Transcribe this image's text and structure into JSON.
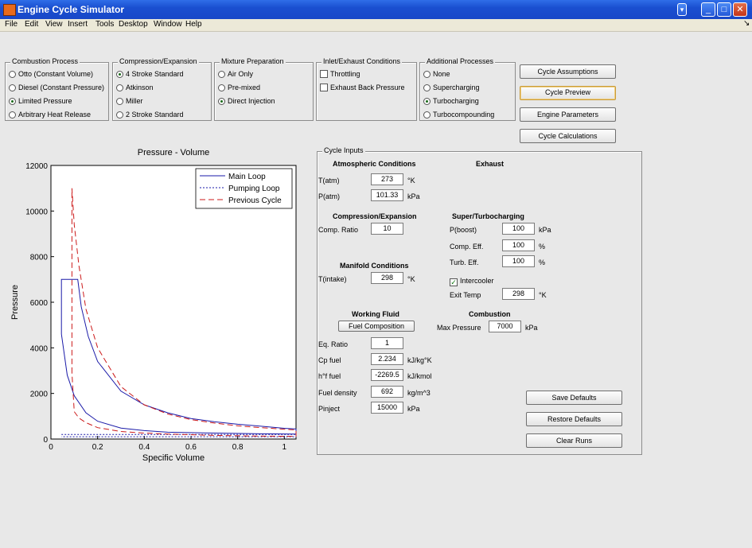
{
  "window": {
    "title": "Engine Cycle Simulator"
  },
  "menu": [
    "File",
    "Edit",
    "View",
    "Insert",
    "Tools",
    "Desktop",
    "Window",
    "Help"
  ],
  "combustion": {
    "title": "Combustion Process",
    "options": [
      "Otto (Constant Volume)",
      "Diesel (Constant Pressure)",
      "Limited Pressure",
      "Arbitrary Heat Release"
    ],
    "selected": 2
  },
  "compression": {
    "title": "Compression/Expansion",
    "options": [
      "4 Stroke Standard",
      "Atkinson",
      "Miller",
      "2 Stroke Standard"
    ],
    "selected": 0
  },
  "mixture": {
    "title": "Mixture Preparation",
    "options": [
      "Air Only",
      "Pre-mixed",
      "Direct Injection"
    ],
    "selected": 2
  },
  "inlet": {
    "title": "Inlet/Exhaust Conditions",
    "options": [
      "Throttling",
      "Exhaust Back Pressure"
    ]
  },
  "additional": {
    "title": "Additional Processes",
    "options": [
      "None",
      "Supercharging",
      "Turbocharging",
      "Turbocompounding"
    ],
    "selected": 2
  },
  "buttons": {
    "assumptions": "Cycle Assumptions",
    "preview": "Cycle Preview",
    "parameters": "Engine Parameters",
    "calculations": "Cycle Calculations",
    "save": "Save Defaults",
    "restore": "Restore Defaults",
    "clear": "Clear Runs",
    "fuel": "Fuel Composition"
  },
  "inputs": {
    "title": "Cycle Inputs",
    "atm_header": "Atmospheric Conditions",
    "exhaust_header": "Exhaust",
    "t_atm_label": "T(atm)",
    "t_atm": "273",
    "t_atm_unit": "°K",
    "p_atm_label": "P(atm)",
    "p_atm": "101.33",
    "p_atm_unit": "kPa",
    "comp_header": "Compression/Expansion",
    "comp_ratio_label": "Comp. Ratio",
    "comp_ratio": "10",
    "super_header": "Super/Turbocharging",
    "p_boost_label": "P(boost)",
    "p_boost": "100",
    "p_boost_unit": "kPa",
    "comp_eff_label": "Comp. Eff.",
    "comp_eff": "100",
    "comp_eff_unit": "%",
    "turb_eff_label": "Turb. Eff.",
    "turb_eff": "100",
    "turb_eff_unit": "%",
    "manifold_header": "Manifold Conditions",
    "t_intake_label": "T(intake)",
    "t_intake": "298",
    "t_intake_unit": "°K",
    "intercooler_label": "Intercooler",
    "exit_temp_label": "Exit Temp",
    "exit_temp": "298",
    "exit_temp_unit": "°K",
    "fluid_header": "Working Fluid",
    "combustion_header": "Combustion",
    "max_pressure_label": "Max Pressure",
    "max_pressure": "7000",
    "max_pressure_unit": "kPa",
    "eq_ratio_label": "Eq. Ratio",
    "eq_ratio": "1",
    "cp_fuel_label": "Cp fuel",
    "cp_fuel": "2.234",
    "cp_fuel_unit": "kJ/kg°K",
    "hf_fuel_label": "h°f fuel",
    "hf_fuel": "-2269.5",
    "hf_fuel_unit": "kJ/kmol",
    "fuel_density_label": "Fuel density",
    "fuel_density": "692",
    "fuel_density_unit": "kg/m^3",
    "pinject_label": "Pinject",
    "pinject": "15000",
    "pinject_unit": "kPa"
  },
  "chart_data": {
    "type": "line",
    "title": "Pressure - Volume",
    "xlabel": "Specific Volume",
    "ylabel": "Pressure",
    "xlim": [
      0,
      1.05
    ],
    "ylim": [
      0,
      12000
    ],
    "xticks": [
      "0",
      "0.2",
      "0.4",
      "0.6",
      "0.8",
      "1"
    ],
    "yticks": [
      "0",
      "2000",
      "4000",
      "6000",
      "8000",
      "10000",
      "12000"
    ],
    "legend_position": "top-right",
    "series": [
      {
        "name": "Main Loop",
        "color": "#1a1aa8",
        "dash": "solid",
        "x": [
          0.045,
          0.045,
          0.115,
          0.13,
          0.16,
          0.2,
          0.3,
          0.4,
          0.5,
          0.6,
          0.7,
          0.8,
          0.9,
          1.0,
          1.05,
          1.05,
          0.9,
          0.7,
          0.5,
          0.4,
          0.3,
          0.2,
          0.15,
          0.1,
          0.07,
          0.045
        ],
        "y": [
          4600,
          7000,
          7000,
          5800,
          4500,
          3400,
          2100,
          1500,
          1150,
          900,
          760,
          650,
          560,
          470,
          440,
          220,
          230,
          260,
          300,
          370,
          480,
          780,
          1150,
          1900,
          2800,
          4600
        ]
      },
      {
        "name": "Pumping Loop",
        "color": "#1a1aa8",
        "dash": "dotted",
        "x": [
          0.045,
          1.05,
          1.05,
          0.045
        ],
        "y": [
          200,
          200,
          100,
          100
        ]
      },
      {
        "name": "Previous Cycle",
        "color": "#cc1a1a",
        "dash": "dashed",
        "x": [
          0.09,
          0.09,
          0.1,
          0.12,
          0.15,
          0.2,
          0.3,
          0.4,
          0.5,
          0.6,
          0.7,
          0.8,
          0.9,
          1.0,
          1.05,
          1.05,
          0.9,
          0.7,
          0.5,
          0.4,
          0.3,
          0.2,
          0.15,
          0.12,
          0.1,
          0.09
        ],
        "y": [
          2900,
          11000,
          9400,
          7600,
          5700,
          4000,
          2300,
          1500,
          1100,
          850,
          700,
          580,
          500,
          430,
          400,
          120,
          130,
          160,
          220,
          260,
          330,
          500,
          720,
          920,
          1200,
          2900
        ]
      }
    ]
  }
}
